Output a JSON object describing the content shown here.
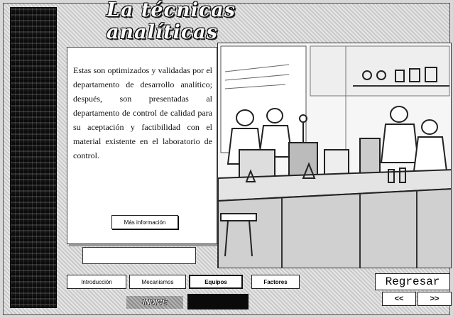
{
  "title": "La técnicas analíticas",
  "content": {
    "paragraph": "Estas son optimizados y validadas por el departamento de desarrollo analítico; después, son presentadas al departamento de control de calidad para su aceptación y factibilidad con el material existente en el laboratorio de control.",
    "more_button": "Más información"
  },
  "tabs": [
    {
      "label": "Introducción"
    },
    {
      "label": "Mecanismos"
    },
    {
      "label": "Equipos"
    },
    {
      "label": "Factores"
    }
  ],
  "indice_label": "INDICE",
  "regresar_label": "Regresar",
  "nav": {
    "prev": "<<",
    "next": ">>"
  }
}
